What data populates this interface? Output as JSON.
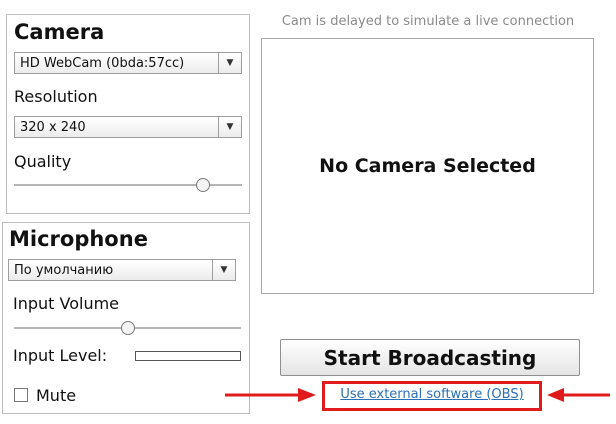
{
  "camera": {
    "heading": "Camera",
    "device_value": "HD WebCam (0bda:57cc)",
    "resolution_label": "Resolution",
    "resolution_value": "320 x 240",
    "quality_label": "Quality",
    "quality_level": 0.83
  },
  "microphone": {
    "heading": "Microphone",
    "device_value": "По умолчанию",
    "input_volume_label": "Input Volume",
    "input_volume_level": 0.5,
    "input_level_label": "Input Level:",
    "input_level_value": 0,
    "mute_label": "Mute",
    "mute_checked": false
  },
  "preview": {
    "notice": "Cam is delayed to simulate a live connection",
    "status_text": "No Camera Selected"
  },
  "actions": {
    "start_label": "Start Broadcasting",
    "obs_link_label": "Use external software (OBS)"
  },
  "colors": {
    "highlight": "#e01b1b",
    "link": "#2b6fb6"
  },
  "icons": {
    "dropdown": "chevron-down-icon",
    "annotation": "red-arrow-icon"
  }
}
